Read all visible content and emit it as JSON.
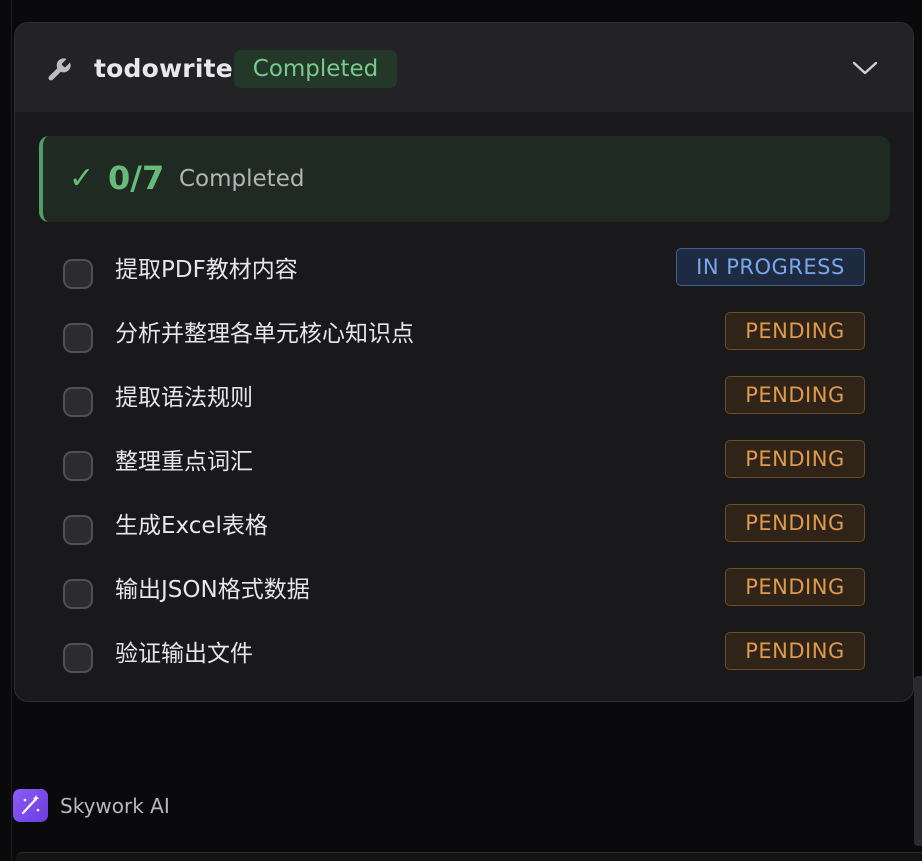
{
  "tool": {
    "name": "todowrite",
    "status": "Completed",
    "icon": "wrench-icon",
    "expand_icon": "chevron-down-icon"
  },
  "progress": {
    "check": "✓",
    "count": "0/7",
    "label": "Completed"
  },
  "tasks": [
    {
      "text": "提取PDF教材内容",
      "status": "IN PROGRESS"
    },
    {
      "text": "分析并整理各单元核心知识点",
      "status": "PENDING"
    },
    {
      "text": "提取语法规则",
      "status": "PENDING"
    },
    {
      "text": "整理重点词汇",
      "status": "PENDING"
    },
    {
      "text": "生成Excel表格",
      "status": "PENDING"
    },
    {
      "text": "输出JSON格式数据",
      "status": "PENDING"
    },
    {
      "text": "验证输出文件",
      "status": "PENDING"
    }
  ],
  "brand": {
    "name": "Skywork AI",
    "icon": "magic-wand-icon"
  },
  "colors": {
    "accent_green": "#66bb79",
    "in_progress_blue": "#79a7ee",
    "pending_orange": "#e09a4c",
    "brand_purple": "#8d5cf6"
  }
}
